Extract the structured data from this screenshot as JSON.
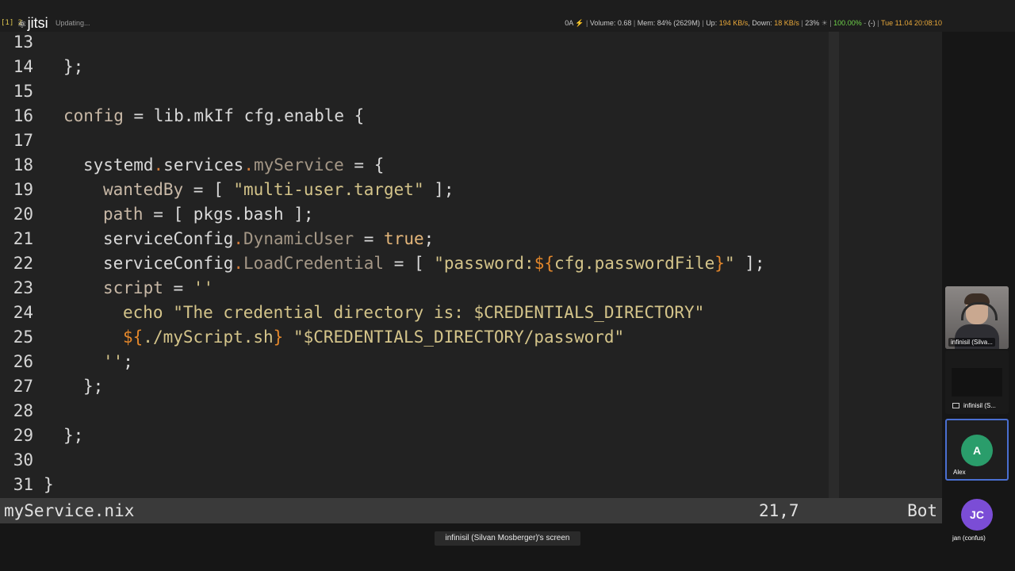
{
  "topbar": {
    "workspace": "[1] 2",
    "app_name": "jitsi",
    "updating": "Updating...",
    "stats": {
      "a": "0A",
      "volume": "Volume: 0.68",
      "mem": "Mem: 84% (2629M)",
      "up_label": "Up:",
      "up_value": "194 KB/s",
      "down_label": "Down:",
      "down_value": "18 KB/s",
      "cpu": "23%",
      "battery": "100.00%",
      "battery_extra": "(-)",
      "datetime": "Tue 11.04 20:08:10"
    }
  },
  "editor": {
    "line_numbers": [
      "13",
      "14",
      "15",
      "16",
      "17",
      "18",
      "19",
      "20",
      "21",
      "22",
      "23",
      "24",
      "25",
      "26",
      "27",
      "28",
      "29",
      "30",
      "31"
    ],
    "lines": {
      "l14": "};",
      "l16_a": "config",
      "l16_b": " = lib.mkIf cfg.enable {",
      "l18_a": "systemd",
      "l18_b": ".",
      "l18_c": "services",
      "l18_d": ".",
      "l18_e": "myService",
      "l18_f": " = {",
      "l19_a": "wantedBy",
      "l19_b": " = [ ",
      "l19_c": "\"multi-user.target\"",
      "l19_d": " ];",
      "l20_a": "path",
      "l20_b": " = [ pkgs.bash ];",
      "l21_a": "serviceConfig",
      "l21_b": ".",
      "l21_c": "DynamicUser",
      "l21_d": " = ",
      "l21_e": "true",
      "l21_f": ";",
      "l22_a": "serviceConfig",
      "l22_b": ".",
      "l22_c": "LoadCredential",
      "l22_d": " = [ ",
      "l22_e": "\"password:",
      "l22_f": "${",
      "l22_g": "cfg.passwordFile",
      "l22_h": "}",
      "l22_i": "\"",
      "l22_j": " ];",
      "l23_a": "script",
      "l23_b": " = ",
      "l23_c": "''",
      "l24": "echo \"The credential directory is: $CREDENTIALS_DIRECTORY\"",
      "l25_a": "${",
      "l25_b": "./myScript.sh",
      "l25_c": "}",
      "l25_d": " \"$CREDENTIALS_DIRECTORY/password\"",
      "l26_a": "''",
      "l26_b": ";",
      "l27": "};",
      "l29": "};",
      "l31": "}"
    }
  },
  "statusline": {
    "filename": "myService.nix",
    "position": "21,7",
    "scroll": "Bot"
  },
  "screen_label": "infinisil (Silvan Mosberger)'s screen",
  "participants": [
    {
      "name": "infinisil (Silva..."
    },
    {
      "name": "infinisil (S..."
    },
    {
      "name": "Alex",
      "initials": "A",
      "color": "#2a9d6b"
    },
    {
      "name": "jan (confus)",
      "initials": "JC",
      "color": "#7b4dd6"
    }
  ]
}
